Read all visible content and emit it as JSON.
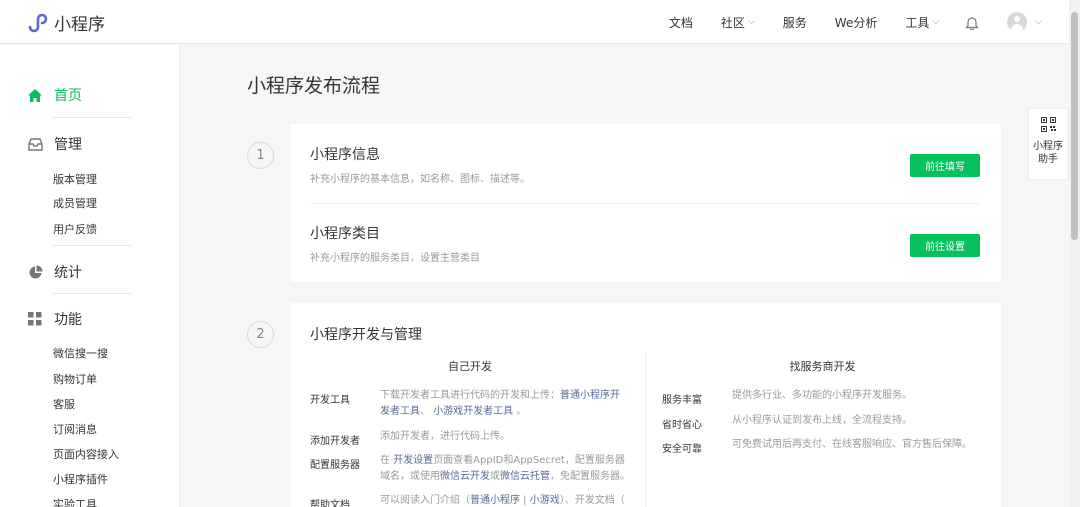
{
  "brand": {
    "name": "小程序"
  },
  "nav": {
    "items": [
      "文档",
      "社区",
      "服务",
      "We分析",
      "工具"
    ]
  },
  "sidebar": {
    "home": "首页",
    "manage": {
      "label": "管理",
      "items": [
        "版本管理",
        "成员管理",
        "用户反馈"
      ]
    },
    "stats": "统计",
    "features": {
      "label": "功能",
      "items": [
        "微信搜一搜",
        "购物订单",
        "客服",
        "订阅消息",
        "页面内容接入",
        "小程序插件",
        "实验工具"
      ]
    }
  },
  "page": {
    "title": "小程序发布流程"
  },
  "step1": {
    "number": "1",
    "info": {
      "title": "小程序信息",
      "desc": "补充小程序的基本信息，如名称、图标、描述等。",
      "button": "前往填写"
    },
    "category": {
      "title": "小程序类目",
      "desc": "补充小程序的服务类目，设置主营类目",
      "button": "前往设置"
    }
  },
  "step2": {
    "number": "2",
    "title": "小程序开发与管理",
    "self_dev": {
      "heading": "自己开发",
      "rows": {
        "tools": {
          "label": "开发工具",
          "t1": "下载开发者工具进行代码的开发和上传：",
          "l1": "普通小程序开",
          "l2": "发者工具",
          "t2": "、",
          "l3": "小游戏开发者工具",
          "t3": "。"
        },
        "add_dev": {
          "label": "添加开发者",
          "t1": "添加开发者，进行代码上传。"
        },
        "server": {
          "label": "配置服务器",
          "t1": "在 ",
          "l1": "开发设置",
          "t2": "页面查看AppID和AppSecret，配置服务器",
          "t3": "域名，或使用",
          "l2": "微信云开发",
          "t4": "或",
          "l3": "微信云托管",
          "t5": "，免配置服务器。"
        },
        "docs": {
          "label": "帮助文档",
          "t1": "可以阅读入门介绍（",
          "l1": "普通小程序",
          "t2": " | ",
          "l2": "小游戏",
          "t3": "）、开发文档（"
        }
      }
    },
    "vendor": {
      "heading": "找服务商开发",
      "rows": [
        {
          "label": "服务丰富",
          "text": "提供多行业、多功能的小程序开发服务。"
        },
        {
          "label": "省时省心",
          "text": "从小程序认证到发布上线，全流程支持。"
        },
        {
          "label": "安全可靠",
          "text": "可免费试用后再支付、在线客服响应、官方售后保障。"
        }
      ]
    }
  },
  "float_help": {
    "line1": "小程序",
    "line2": "助手"
  },
  "colors": {
    "accent": "#07c160",
    "link": "#576b95",
    "muted": "#9a9a9a"
  },
  "icons": [
    "miniprogram-logo-icon",
    "bell-icon",
    "home-icon",
    "inbox-icon",
    "pie-chart-icon",
    "grid-icon",
    "qrcode-icon"
  ]
}
